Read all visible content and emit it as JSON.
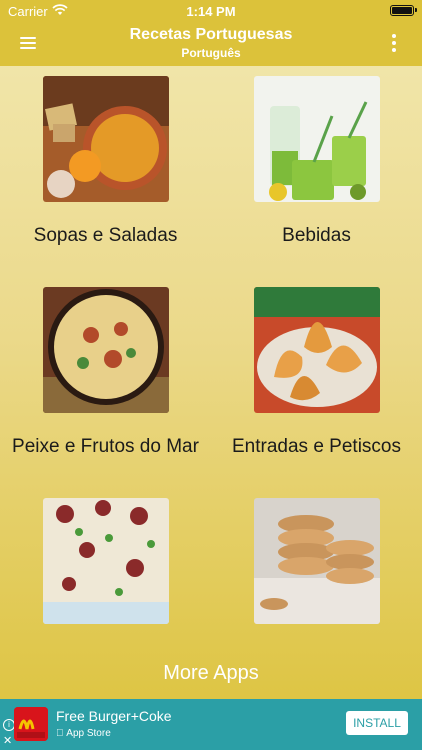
{
  "status": {
    "carrier": "Carrier",
    "time": "1:14 PM"
  },
  "nav": {
    "title": "Recetas Portuguesas",
    "subtitle": "Português"
  },
  "categories": [
    {
      "label": "Sopas e Saladas",
      "icon": "soup-bowl-photo"
    },
    {
      "label": "Bebidas",
      "icon": "green-drinks-photo"
    },
    {
      "label": "Peixe e Frutos do Mar",
      "icon": "seafood-pan-photo"
    },
    {
      "label": "Entradas e Petiscos",
      "icon": "croquettes-photo"
    },
    {
      "label": "",
      "icon": "rice-sausage-photo"
    },
    {
      "label": "",
      "icon": "cookies-photo"
    }
  ],
  "more_apps": "More Apps",
  "ad": {
    "title": "Free Burger+Coke",
    "store": "App Store",
    "install": "INSTALL",
    "brand": "McDelivery"
  },
  "colors": {
    "bar": "#dcc23a",
    "ad": "#2b9fa6"
  }
}
